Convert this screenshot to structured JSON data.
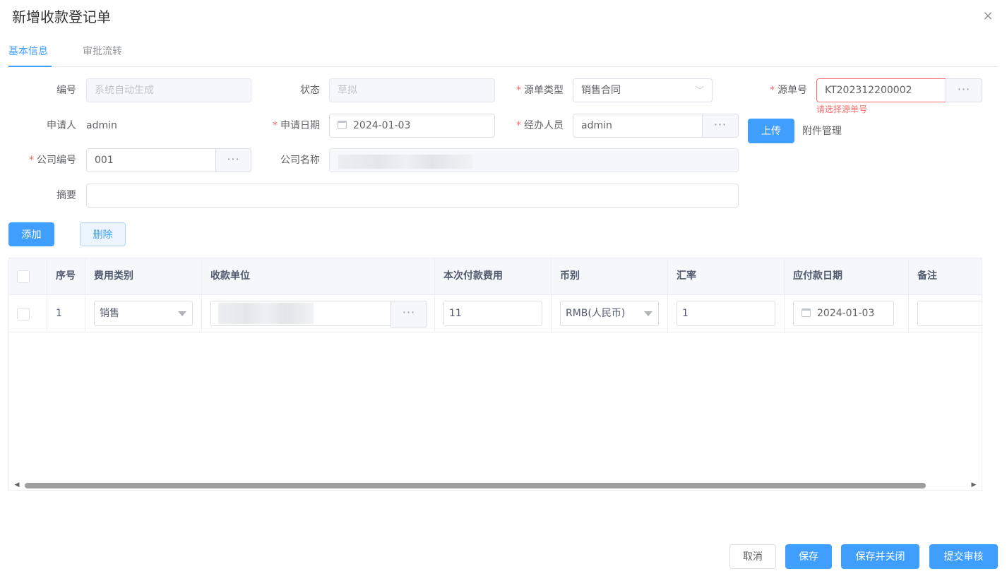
{
  "dialog": {
    "title": "新增收款登记单",
    "close_icon": "×"
  },
  "tabs": [
    {
      "label": "基本信息",
      "active": true
    },
    {
      "label": "审批流转",
      "active": false
    }
  ],
  "form": {
    "code": {
      "label": "编号",
      "placeholder": "系统自动生成"
    },
    "status": {
      "label": "状态",
      "placeholder": "草拟"
    },
    "source_type": {
      "label": "源单类型",
      "value": "销售合同",
      "required": true
    },
    "source_no": {
      "label": "源单号",
      "value": "KT202312200002",
      "required": true,
      "error": "请选择源单号"
    },
    "applicant": {
      "label": "申请人",
      "value": "admin"
    },
    "apply_date": {
      "label": "申请日期",
      "value": "2024-01-03",
      "required": true
    },
    "handler": {
      "label": "经办人员",
      "value": "admin",
      "required": true
    },
    "upload_label": "上传",
    "attachment_label": "附件管理",
    "company_code": {
      "label": "公司编号",
      "value": "001",
      "required": true
    },
    "company_name": {
      "label": "公司名称"
    },
    "summary": {
      "label": "摘要",
      "value": ""
    },
    "ellipsis": "···",
    "required_mark": "*"
  },
  "toolbar": {
    "add_label": "添加",
    "delete_label": "删除"
  },
  "table": {
    "columns": [
      "序号",
      "费用类别",
      "收款单位",
      "本次付款费用",
      "币别",
      "汇率",
      "应付款日期",
      "备注"
    ],
    "rows": [
      {
        "index": "1",
        "fee_type": "销售",
        "amount": "11",
        "currency": "RMB(人民币)",
        "rate": "1",
        "due_date": "2024-01-03",
        "remark": ""
      }
    ],
    "scroll_left_icon": "◀",
    "scroll_right_icon": "▶"
  },
  "footer": {
    "cancel_label": "取消",
    "save_label": "保存",
    "save_close_label": "保存并关闭",
    "submit_label": "提交审核"
  },
  "colors": {
    "primary": "#409eff",
    "danger": "#f56c6c"
  }
}
